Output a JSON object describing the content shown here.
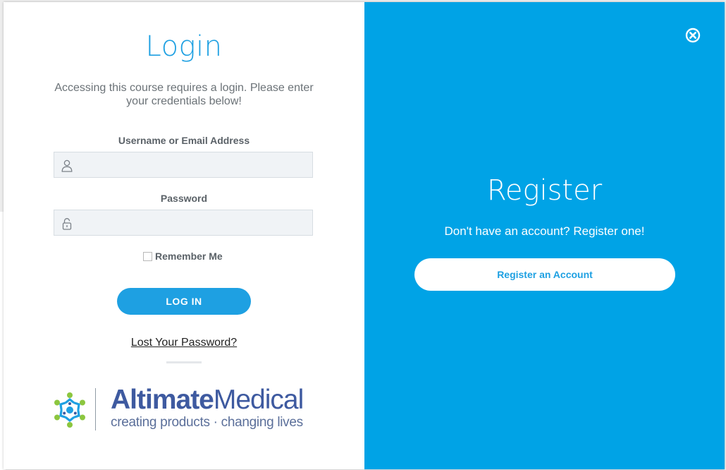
{
  "colors": {
    "accent": "#1ea0e2",
    "register_panel": "#00a3e6",
    "field_bg": "#f0f3f6",
    "logo_text": "#3e5aa0"
  },
  "login": {
    "title": "Login",
    "description": "Accessing this course requires a login. Please enter your credentials below!",
    "username": {
      "label": "Username or Email Address",
      "value": "",
      "icon": "user-icon"
    },
    "password": {
      "label": "Password",
      "value": "",
      "icon": "lock-icon"
    },
    "remember_me": {
      "label": "Remember Me",
      "checked": false
    },
    "submit_label": "LOG IN",
    "lost_password": "Lost Your Password?"
  },
  "logo": {
    "word_bold": "Altimate",
    "word_light": "Medical",
    "tagline": "creating products · changing lives"
  },
  "register": {
    "title": "Register",
    "description": "Don't have an account? Register one!",
    "button_label": "Register an Account",
    "close_icon": "close-circle-icon"
  }
}
